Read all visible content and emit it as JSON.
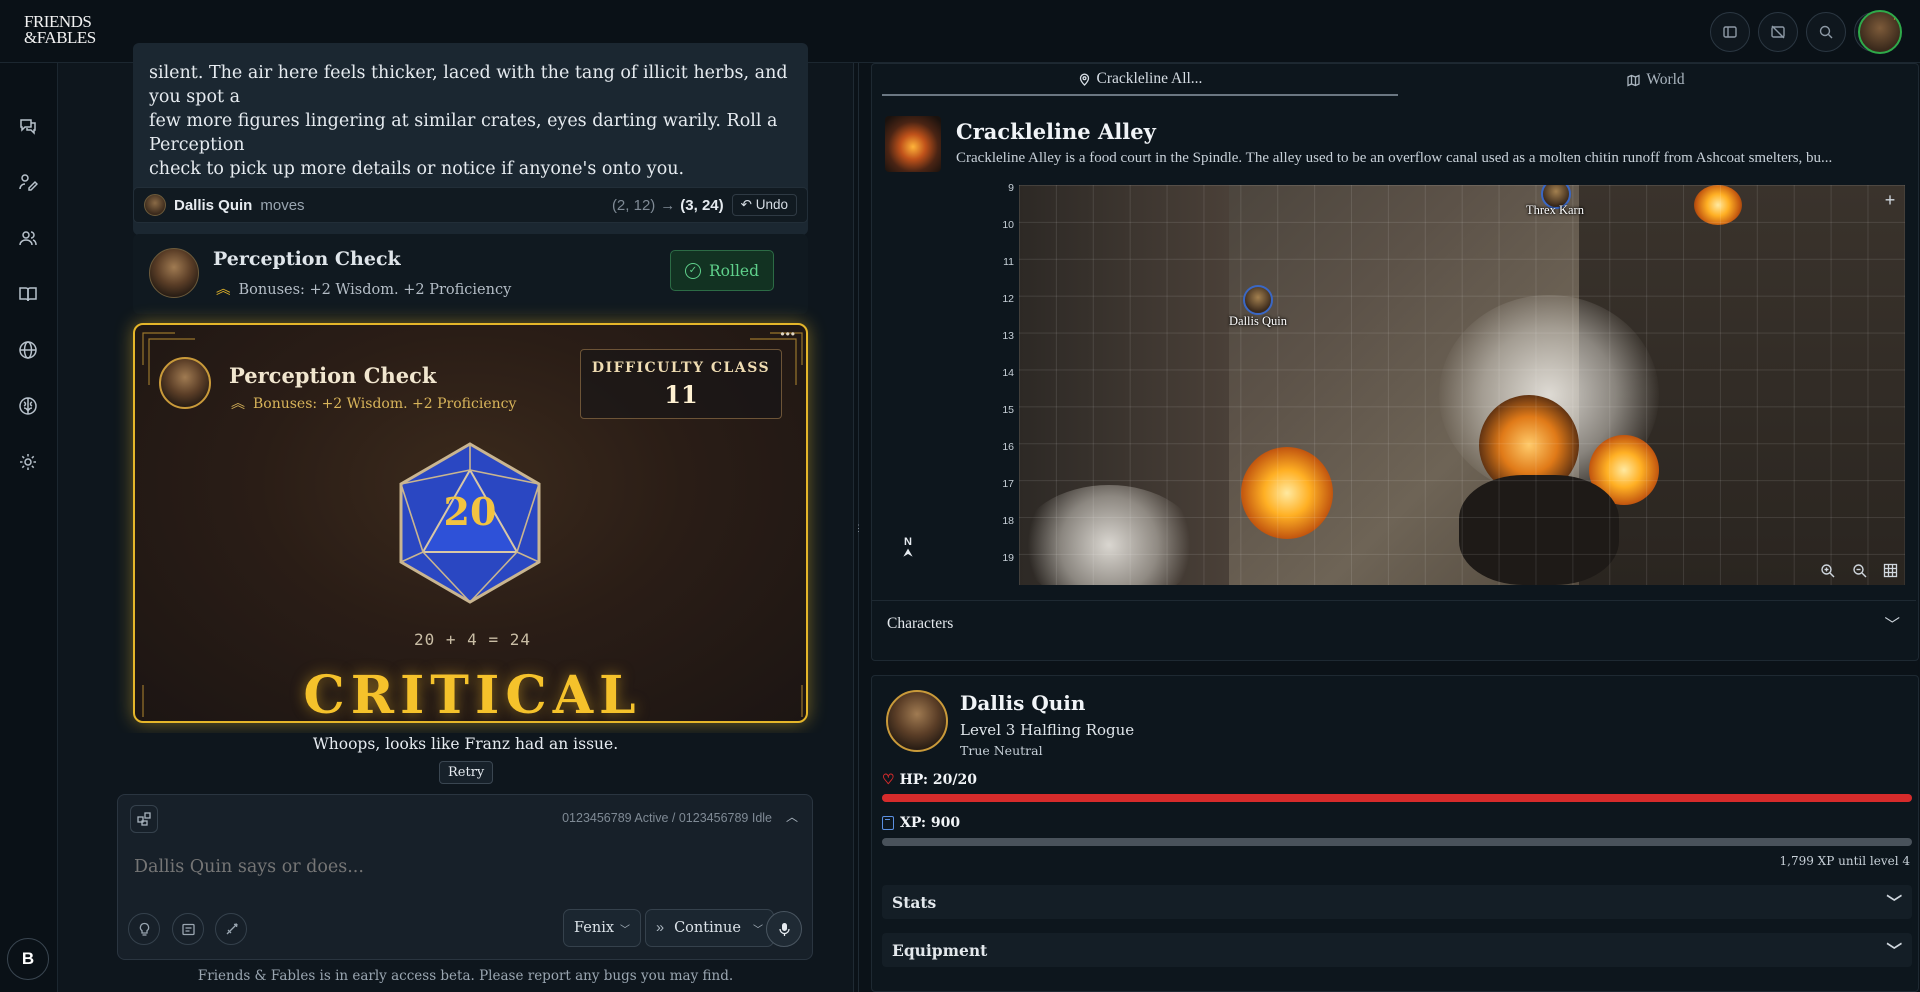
{
  "app": {
    "logo_line1": "FRIENDS",
    "logo_line2": "&FABLES"
  },
  "header_icons": [
    "sidebar-toggle-icon",
    "hide-image-icon",
    "search-icon",
    "add-user-icon"
  ],
  "rail": {
    "items": [
      "chat-icon",
      "edit-character-icon",
      "party-icon",
      "book-icon",
      "globe-icon",
      "brain-icon",
      "settings-icon"
    ],
    "user_initial": "B"
  },
  "narration": {
    "line1": "silent. The air here feels thicker, laced with the tang of illicit herbs, and you spot a",
    "line2": "few more figures lingering at similar crates, eyes darting warily. Roll a Perception",
    "line3": "check to pick up more details or notice if anyone's onto you."
  },
  "move": {
    "character": "Dallis Quin",
    "verb": "moves",
    "from": "(2, 12)",
    "arrow": "→",
    "to": "(3, 24)",
    "undo_label": "Undo"
  },
  "check_summary": {
    "title": "Perception Check",
    "bonuses": "Bonuses: +2 Wisdom. +2 Proficiency",
    "status_label": "Rolled"
  },
  "roll_card": {
    "title": "Perception Check",
    "bonuses": "Bonuses: +2 Wisdom. +2 Proficiency",
    "dc_label": "DIFFICULTY CLASS",
    "dc_value": "11",
    "die_value": "20",
    "equation": "20 + 4 = 24",
    "result": "CRITICAL SUCCESS!",
    "menu": "•••"
  },
  "error": {
    "message": "Whoops, looks like Franz had an issue.",
    "retry_label": "Retry"
  },
  "composer": {
    "status": "0123456789 Active / 0123456789 Idle",
    "placeholder": "Dallis Quin says or does...",
    "model": "Fenix",
    "mode": "Continue"
  },
  "footer": "Friends & Fables is in early access beta. Please report any bugs you may find.",
  "map_panel": {
    "tabs": [
      {
        "label": "Crackleline All...",
        "active": true
      },
      {
        "label": "World",
        "active": false
      }
    ],
    "location_name": "Crackleline Alley",
    "location_desc": "Crackleline Alley is a food court in the Spindle. The alley used to be an overflow canal used as a molten chitin runoff from Ashcoat smelters, bu...",
    "row_labels": [
      "9",
      "10",
      "11",
      "12",
      "13",
      "14",
      "15",
      "16",
      "17",
      "18",
      "19"
    ],
    "compass": "N",
    "tokens": [
      {
        "name": "Threx Karn"
      },
      {
        "name": "Dallis Quin"
      }
    ],
    "characters_label": "Characters"
  },
  "character": {
    "name": "Dallis Quin",
    "class_line": "Level 3 Halfling Rogue",
    "alignment": "True Neutral",
    "hp_label": "HP: 20/20",
    "hp_fraction": 1.0,
    "xp_label": "XP: 900",
    "xp_fraction": 0.0,
    "xp_next": "1,799 XP until level 4",
    "sections": [
      "Stats",
      "Equipment"
    ]
  },
  "colors": {
    "accent_gold": "#e5b62a",
    "hp_red": "#d62b2b",
    "success_green": "#5fd08b",
    "die_blue": "#2a47c2"
  }
}
